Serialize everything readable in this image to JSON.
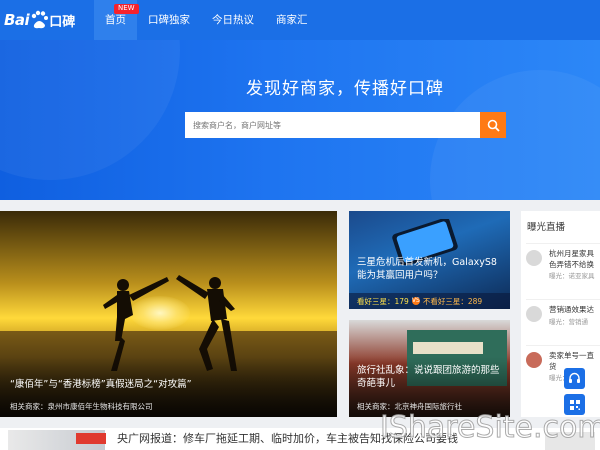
{
  "header": {
    "logo": {
      "prefix": "Bai",
      "suffix": "口碑"
    },
    "nav": [
      {
        "label": "首页",
        "badge": "NEW",
        "active": true
      },
      {
        "label": "口碑独家"
      },
      {
        "label": "今日热议"
      },
      {
        "label": "商家汇"
      }
    ]
  },
  "hero": {
    "title": "发现好商家，传播好口碑",
    "search_placeholder": "搜索商户名，商户网址等"
  },
  "feature": {
    "title": "“康佰年”与“香港标榜”真假迷局之“对攻篇”",
    "meta": "相关商家：泉州市康佰年生物科技有限公司"
  },
  "story1": {
    "title_line1": "三星危机后首发新机，GalaxyS8",
    "title_line2": "能为其赢回用户吗？",
    "good_label": "看好三星：179",
    "vs": "VS",
    "bad_label": "不看好三星：289"
  },
  "story2": {
    "title_line1": "旅行社乱象：说说跟团旅游的那些",
    "title_line2": "奇葩事儿",
    "meta": "相关商家：北京神舟国际旅行社"
  },
  "live": {
    "title": "曝光直播",
    "items": [
      {
        "name": "杭州月星家具",
        "line2": "色弄错不给换",
        "meta": "曝光：诺亚家具"
      },
      {
        "name": "营销通效果达",
        "line2": "",
        "meta": "曝光：营销通"
      },
      {
        "name": "卖家单号一直",
        "line2": "货",
        "meta": "曝光：淘宝"
      }
    ]
  },
  "bottom": {
    "text": "央广网报道：修车厂拖延工期、临时加价，车主被告知找保险公司要钱"
  },
  "watermark": "IShareSite.com"
}
